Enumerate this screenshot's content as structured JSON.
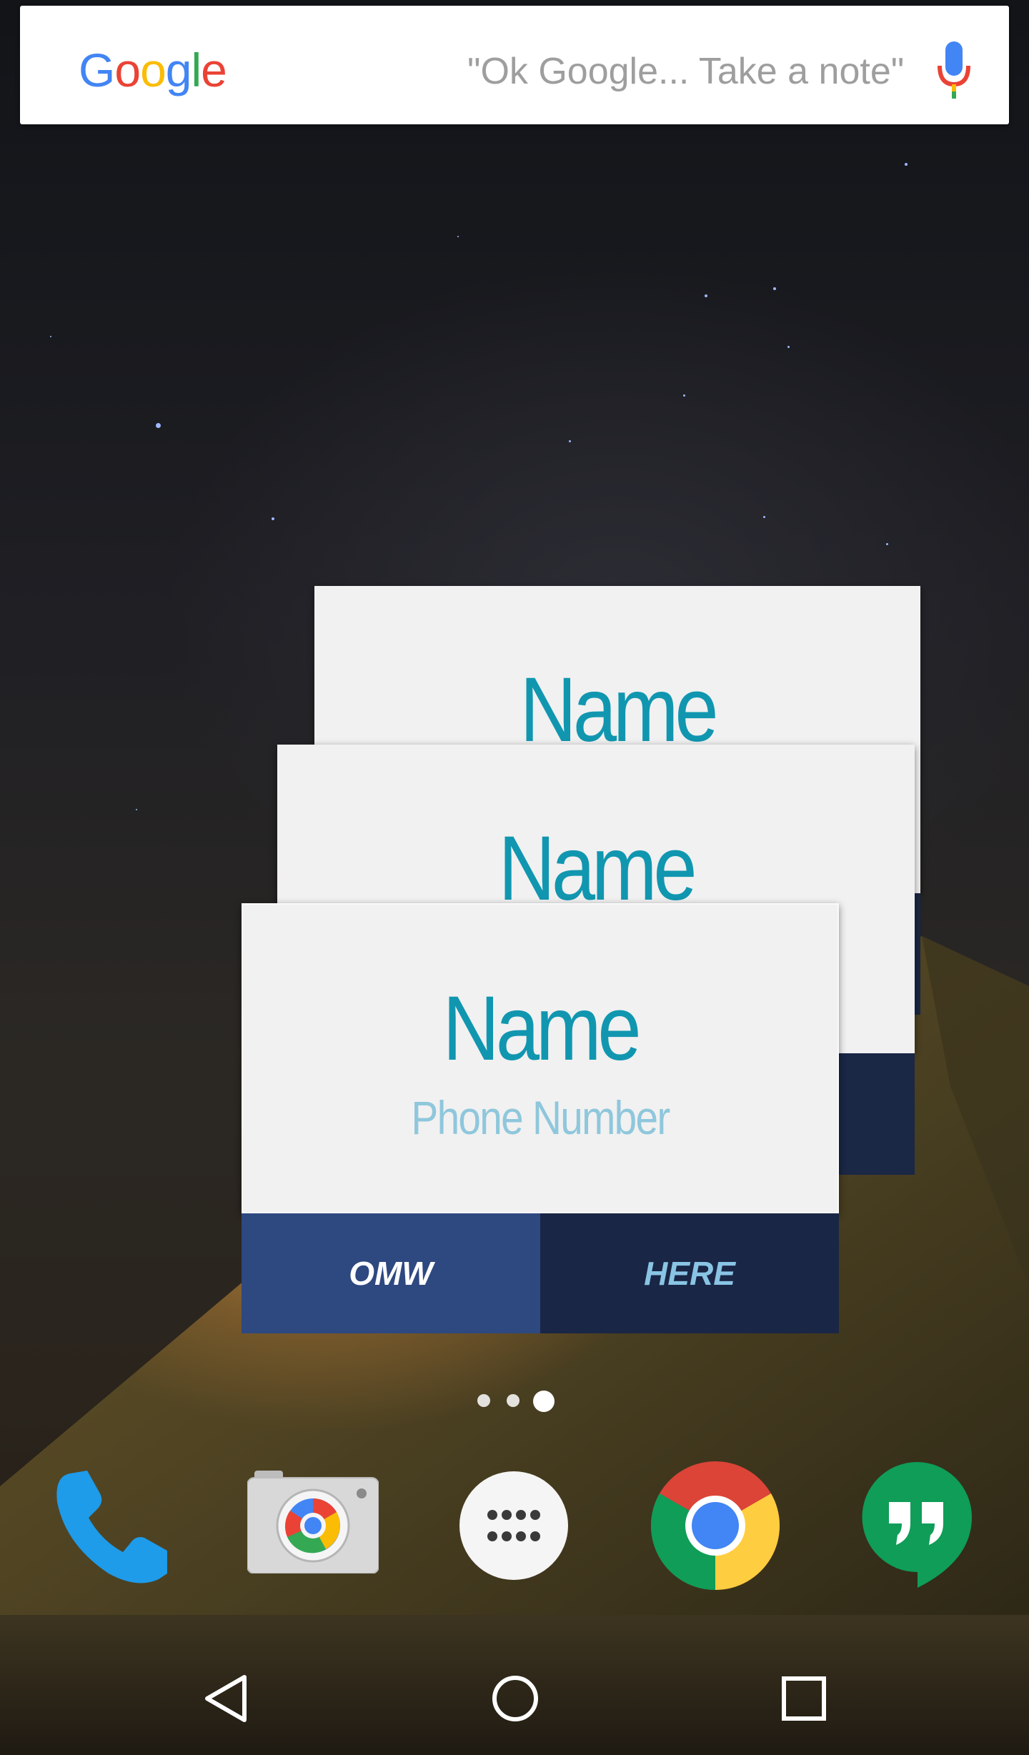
{
  "search": {
    "logo_letters": [
      {
        "char": "G",
        "color": "#4285F4"
      },
      {
        "char": "o",
        "color": "#EA4335"
      },
      {
        "char": "o",
        "color": "#FBBC05"
      },
      {
        "char": "g",
        "color": "#4285F4"
      },
      {
        "char": "l",
        "color": "#34A853"
      },
      {
        "char": "e",
        "color": "#EA4335"
      }
    ],
    "hint": "\"Ok Google... Take a note\"",
    "mic_icon": "mic-icon"
  },
  "cards": {
    "back": {
      "name": "Name"
    },
    "middle": {
      "name": "Name"
    },
    "front": {
      "name": "Name",
      "phone": "Phone Number"
    },
    "buttons": {
      "omw": "OMW",
      "here": "HERE"
    },
    "colors": {
      "name": "#1196b0",
      "phone": "#8fc7dc",
      "omw_bg": "#2e4880",
      "here_bg": "#1a2645",
      "card_bg": "#f1f1f1"
    }
  },
  "page_indicator": {
    "pages": 3,
    "current": 3
  },
  "dock": {
    "apps": [
      {
        "name": "Phone",
        "icon": "phone-icon"
      },
      {
        "name": "Camera",
        "icon": "camera-icon"
      },
      {
        "name": "App drawer",
        "icon": "app-drawer-icon"
      },
      {
        "name": "Chrome",
        "icon": "chrome-icon"
      },
      {
        "name": "Hangouts",
        "icon": "hangouts-icon"
      }
    ]
  },
  "nav": {
    "back": "back-icon",
    "home": "home-icon",
    "recents": "recents-icon"
  }
}
